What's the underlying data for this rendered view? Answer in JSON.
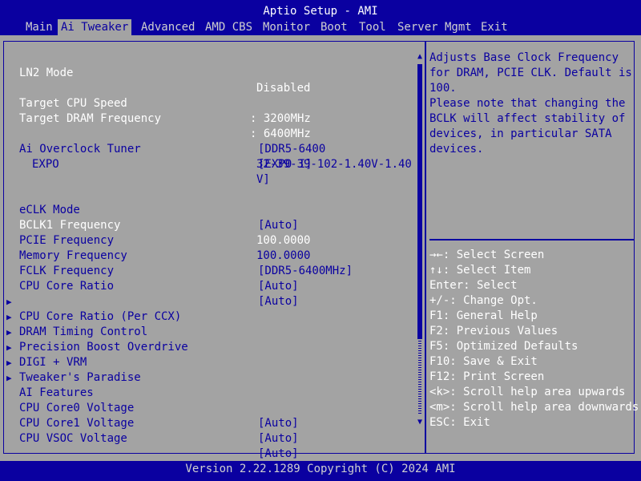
{
  "title": "Aptio Setup - AMI",
  "tabs": [
    "Main",
    "Ai Tweaker",
    "Advanced",
    "AMD CBS",
    "Monitor",
    "Boot",
    "Tool",
    "Server Mgmt",
    "Exit"
  ],
  "active_tab": "Ai Tweaker",
  "settings": {
    "ln2_mode": {
      "label": "LN2 Mode",
      "value": "Disabled"
    },
    "target_cpu_speed": {
      "label": "Target CPU Speed",
      "value": ": 3200MHz"
    },
    "target_dram_frequency": {
      "label": "Target DRAM Frequency",
      "value": ": 6400MHz"
    },
    "ai_overclock_tuner": {
      "label": "Ai Overclock Tuner",
      "value": "[EXPO I]"
    },
    "expo": {
      "label": "EXPO",
      "value_lines": [
        "[DDR5-6400",
        "32-39-39-102-1.40V-1.40",
        "V]"
      ]
    },
    "eclk_mode": {
      "label": "eCLK Mode",
      "value": "[Auto]"
    },
    "bclk1_frequency": {
      "label": "BCLK1 Frequency",
      "value": "100.0000"
    },
    "pcie_frequency": {
      "label": "PCIE Frequency",
      "value": "100.0000"
    },
    "memory_frequency": {
      "label": "Memory Frequency",
      "value": "[DDR5-6400MHz]"
    },
    "fclk_frequency": {
      "label": "FCLK Frequency",
      "value": "[Auto]"
    },
    "cpu_core_ratio": {
      "label": "CPU Core Ratio",
      "value": "[Auto]"
    },
    "cpu_core0_voltage": {
      "label": "CPU Core0 Voltage",
      "value": "[Auto]"
    },
    "cpu_core1_voltage": {
      "label": "CPU Core1 Voltage",
      "value": "[Auto]"
    },
    "cpu_vsoc_voltage": {
      "label": "CPU VSOC Voltage",
      "value": "[Auto]"
    }
  },
  "submenus": [
    "CPU Core Ratio (Per CCX)",
    "DRAM Timing Control",
    "Precision Boost Overdrive",
    "DIGI + VRM",
    "Tweaker's Paradise",
    "AI Features"
  ],
  "submenu_marker": "▶",
  "scroll": {
    "up": "▲",
    "down": "▼"
  },
  "help_text": [
    "Adjusts Base Clock Frequency",
    "for DRAM, PCIE CLK. Default is",
    "100.",
    "Please note that changing the",
    "BCLK will affect stability of",
    "devices, in particular SATA",
    "devices."
  ],
  "key_help": [
    "→←: Select Screen",
    "↑↓: Select Item",
    "Enter: Select",
    "+/-: Change Opt.",
    "F1: General Help",
    "F2: Previous Values",
    "F5: Optimized Defaults",
    "F10: Save & Exit",
    "F12: Print Screen",
    "<k>: Scroll help area upwards",
    "<m>: Scroll help area downwards",
    "ESC: Exit"
  ],
  "footer": "Version 2.22.1289 Copyright (C) 2024 AMI",
  "colors": {
    "blue": "#0a00a0",
    "panel": "#a3a3a3",
    "white": "#ffffff",
    "tab_text": "#cfcfcf"
  }
}
